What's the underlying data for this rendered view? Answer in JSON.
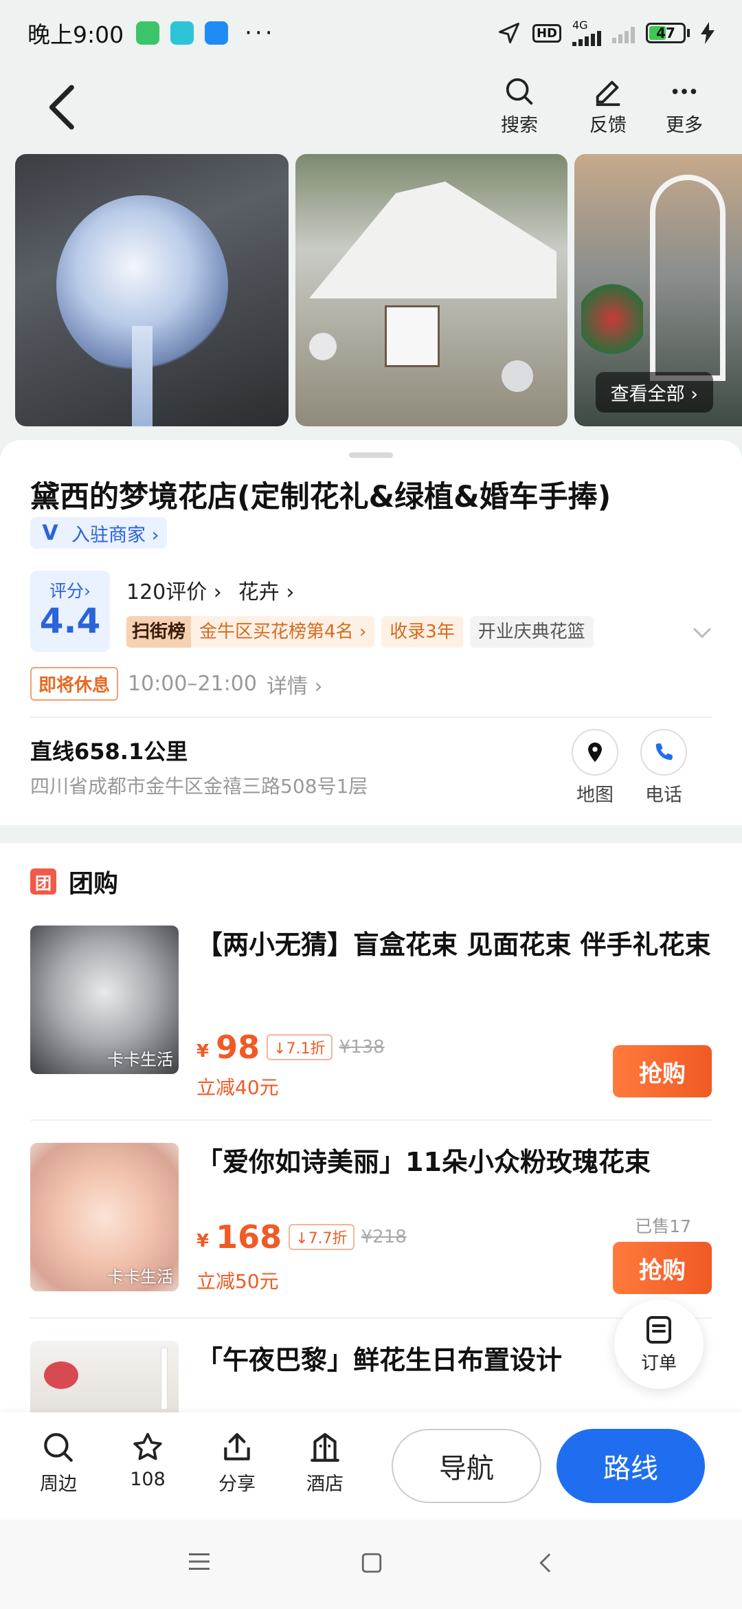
{
  "status_bar": {
    "time": "晚上9:00",
    "network": "4G",
    "hd": "HD",
    "battery": "47",
    "battery_level": 0.47
  },
  "header": {
    "search_label": "搜索",
    "feedback_label": "反馈",
    "more_label": "更多"
  },
  "gallery": {
    "see_all": "查看全部 ›"
  },
  "store": {
    "name": "黛西的梦境花店(定制花礼&绿植&婚车手捧)",
    "merchant_badge": "入驻商家 ›",
    "score_label": "评分›",
    "score": "4.4",
    "reviews": "120评价 ›",
    "category": "花卉 ›",
    "rank_key": "扫街榜",
    "rank_text": "金牛区买花榜第4名 ›",
    "years_tag": "收录3年",
    "feature_tag": "开业庆典花篮",
    "status": "即将休息",
    "hours": "10:00–21:00",
    "details": "详情 ›",
    "distance": "直线658.1公里",
    "address": "四川省成都市金牛区金禧三路508号1层",
    "map_label": "地图",
    "phone_label": "电话"
  },
  "group_buy": {
    "title": "团购",
    "badge": "团",
    "items": [
      {
        "name": "【两小无猜】盲盒花束 见面花束 伴手礼花束",
        "currency": "¥",
        "price": "98",
        "discount": "7.1折",
        "original": "¥138",
        "save": "立减40元",
        "sold": "",
        "watermark": "卡卡生活",
        "buy": "抢购"
      },
      {
        "name": "「爱你如诗美丽」11朵小众粉玫瑰花束",
        "currency": "¥",
        "price": "168",
        "discount": "7.7折",
        "original": "¥218",
        "save": "立减50元",
        "sold": "已售17",
        "watermark": "卡卡生活",
        "buy": "抢购"
      },
      {
        "name": "「午夜巴黎」鲜花生日布置设计"
      }
    ]
  },
  "order_fab": "订单",
  "bottom_bar": {
    "nearby": "周边",
    "favorites": "108",
    "share": "分享",
    "hotel": "酒店",
    "navigate": "导航",
    "route": "路线"
  },
  "colors": {
    "accent_blue": "#1f6ef0",
    "accent_orange": "#f05a24"
  }
}
